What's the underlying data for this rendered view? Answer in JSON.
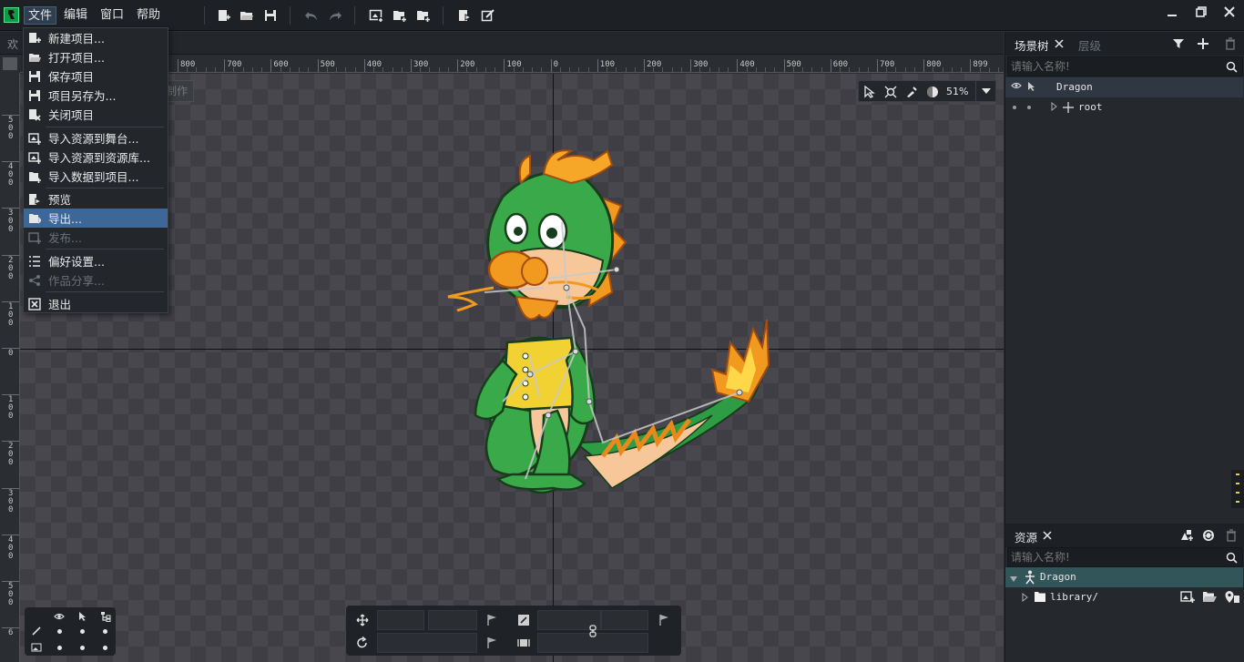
{
  "menubar": {
    "items": [
      "文件",
      "编辑",
      "窗口",
      "帮助"
    ]
  },
  "toolbar": {
    "icons": [
      "new-project-icon",
      "open-project-icon",
      "save-icon",
      "undo-icon",
      "redo-icon",
      "import-to-stage-icon",
      "import-to-library-icon",
      "import-data-icon",
      "preview-icon",
      "export-icon"
    ]
  },
  "tabs": {
    "welcome": "欢"
  },
  "ruler": {
    "top_labels": [
      "800",
      "700",
      "600",
      "500",
      "400",
      "300",
      "200",
      "100",
      "0",
      "100",
      "200",
      "300",
      "400",
      "500",
      "600",
      "700",
      "800",
      "899"
    ],
    "left_labels": [
      "500",
      "400",
      "300",
      "200",
      "100",
      "0",
      "100",
      "200",
      "300",
      "400",
      "500",
      "6"
    ]
  },
  "file_menu": {
    "items": [
      {
        "label": "新建项目...",
        "icon": "new-project-icon",
        "enabled": true
      },
      {
        "label": "打开项目...",
        "icon": "open-folder-icon",
        "enabled": true
      },
      {
        "label": "保存项目",
        "icon": "save-icon",
        "enabled": true
      },
      {
        "label": "项目另存为...",
        "icon": "save-as-icon",
        "enabled": true
      },
      {
        "label": "关闭项目",
        "icon": "close-project-icon",
        "enabled": true
      },
      {
        "label": "导入资源到舞台...",
        "icon": "import-stage-icon",
        "enabled": true
      },
      {
        "label": "导入资源到资源库...",
        "icon": "import-library-icon",
        "enabled": true
      },
      {
        "label": "导入数据到项目...",
        "icon": "import-data-icon",
        "enabled": true
      },
      {
        "label": "预览",
        "icon": "preview-icon",
        "enabled": true
      },
      {
        "label": "导出...",
        "icon": "export-icon",
        "enabled": true,
        "highlighted": true
      },
      {
        "label": "发布...",
        "icon": "publish-icon",
        "enabled": false
      },
      {
        "label": "偏好设置...",
        "icon": "preferences-icon",
        "enabled": true
      },
      {
        "label": "作品分享...",
        "icon": "share-icon",
        "enabled": false
      },
      {
        "label": "退出",
        "icon": "exit-icon",
        "enabled": true
      }
    ]
  },
  "ghost_button": "制作",
  "view_toolbar": {
    "zoom": "51%"
  },
  "scene_tree": {
    "tab_label": "场景树",
    "tab2_label": "层级",
    "search_placeholder": "请输入名称!",
    "root_label": "Dragon",
    "child_label": "root"
  },
  "assets": {
    "tab_label": "资源",
    "search_placeholder": "请输入名称!",
    "root_label": "Dragon",
    "folder_label": "library/"
  },
  "colors": {
    "menu_highlight": "#3d6797",
    "accent_green": "#0f9a4a"
  }
}
